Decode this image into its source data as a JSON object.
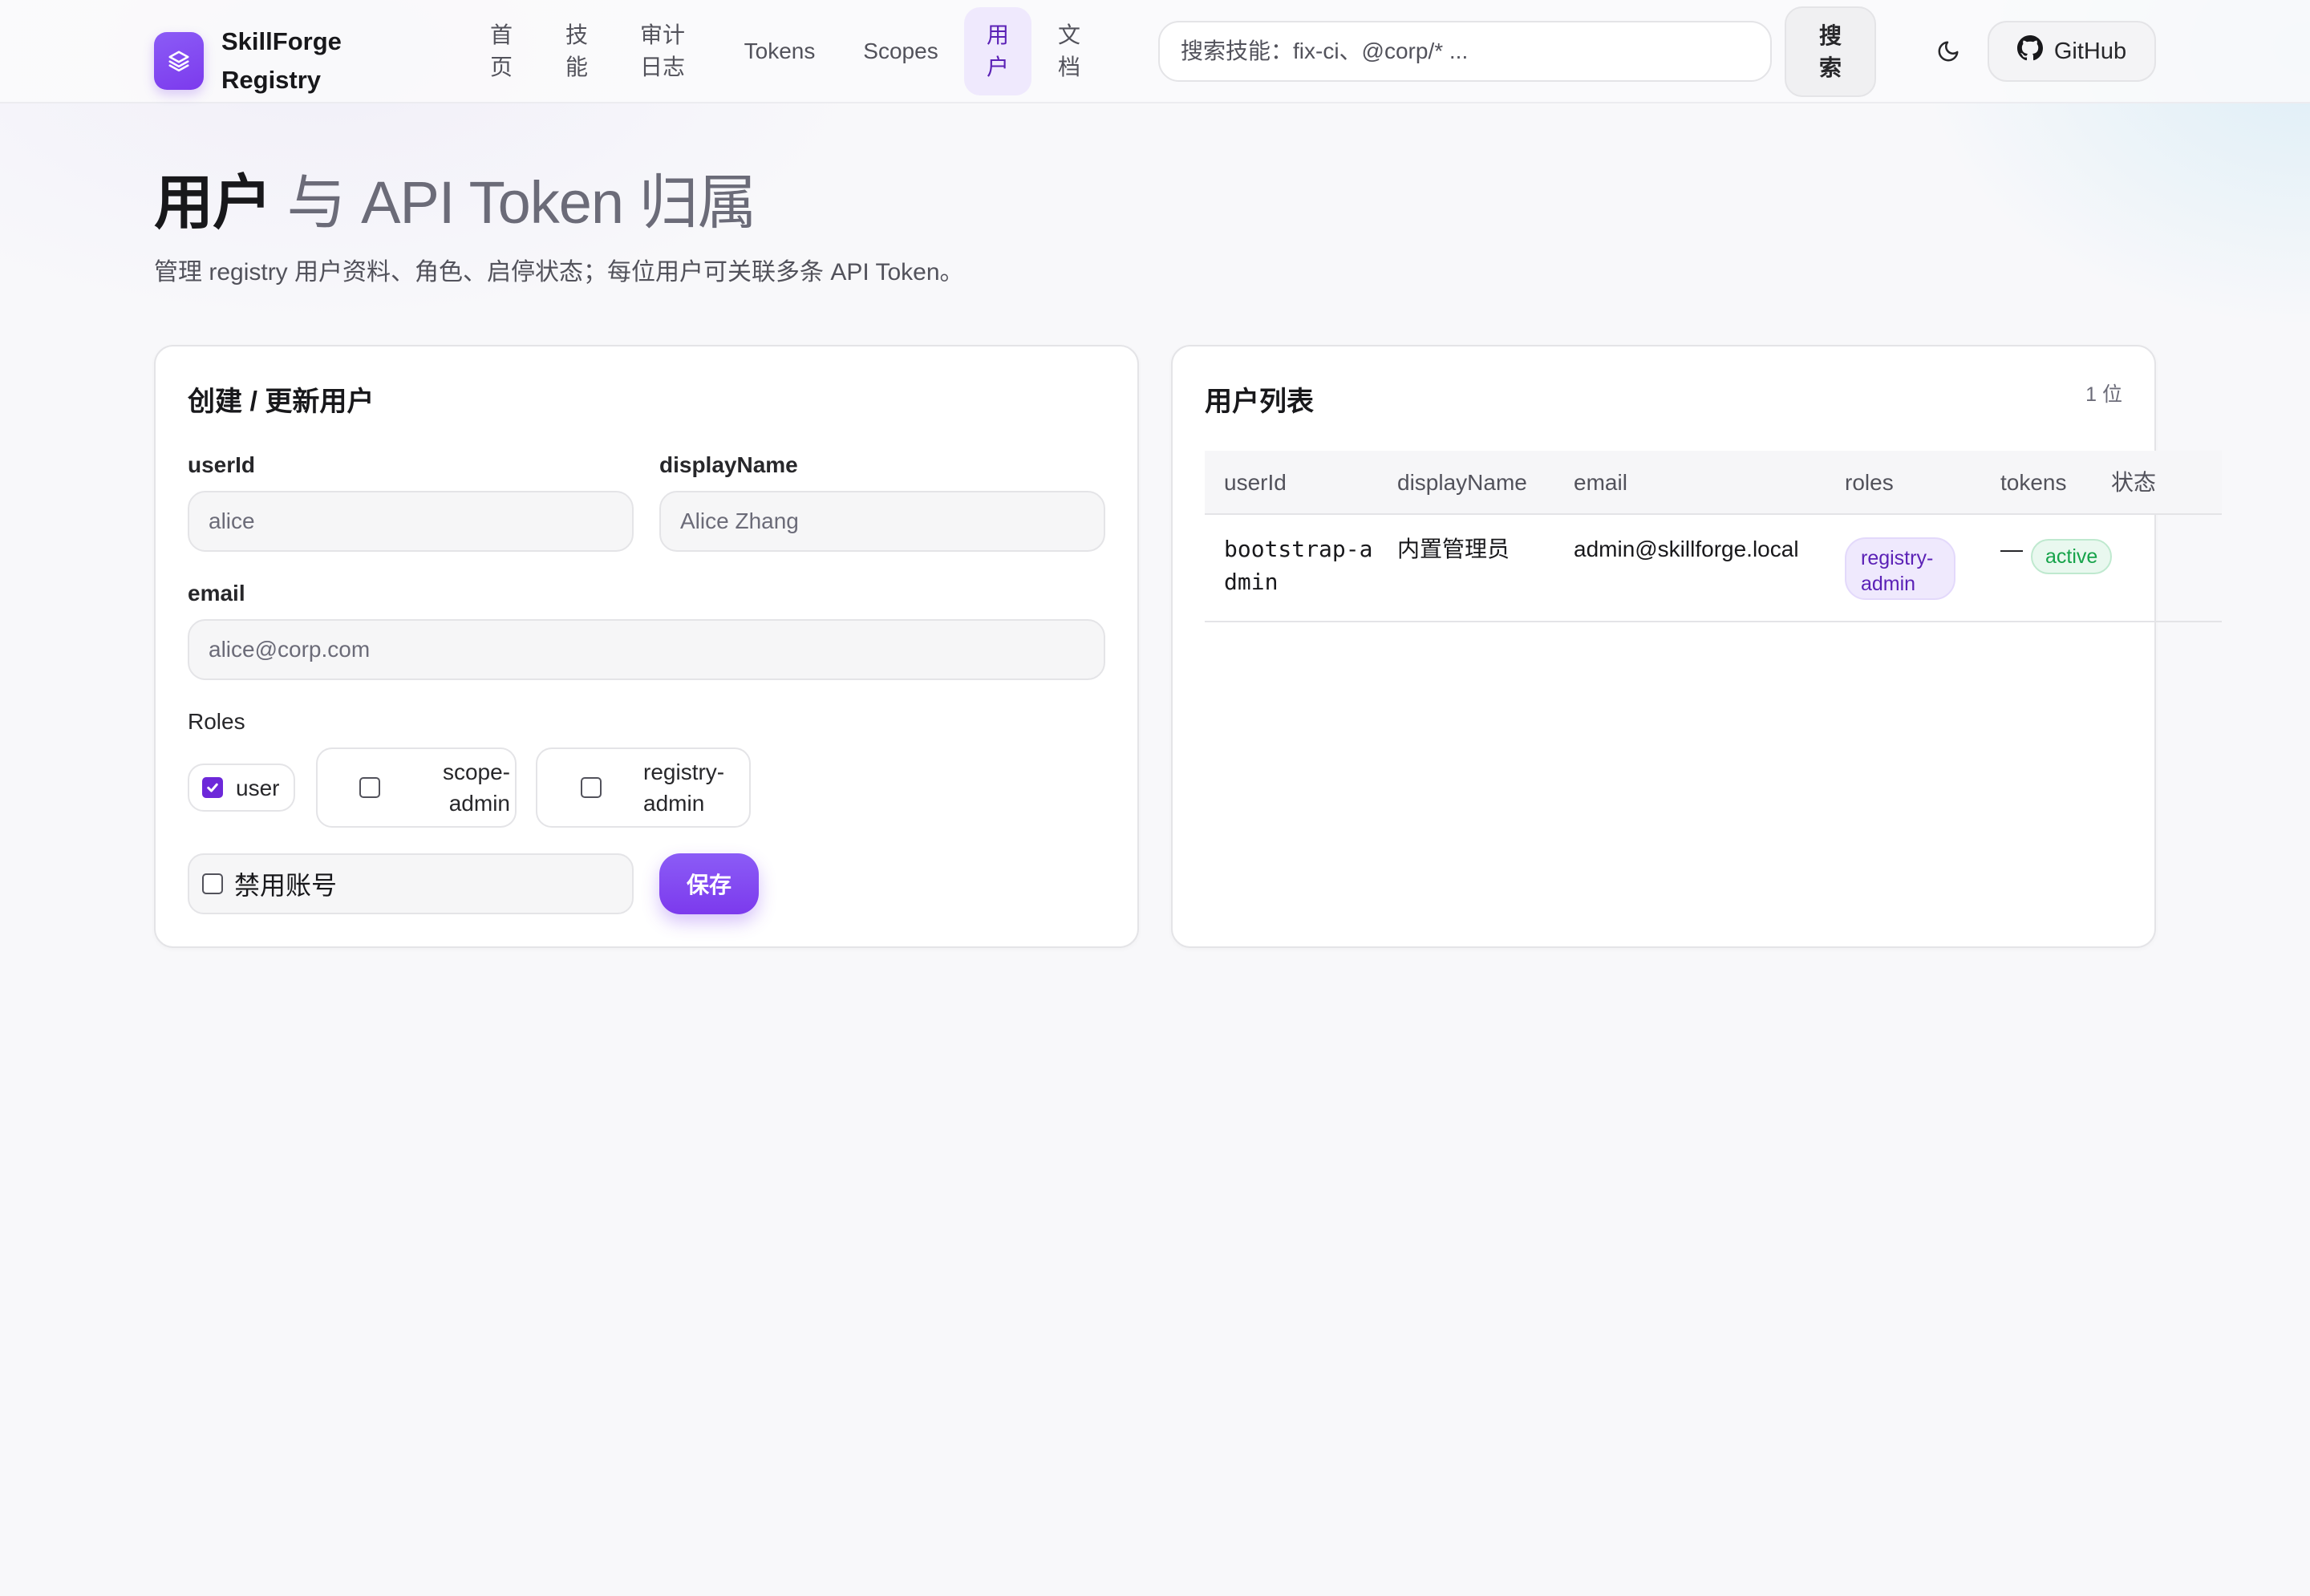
{
  "brand": {
    "name": "SkillForge Registry"
  },
  "nav": {
    "items": [
      {
        "label": "首页"
      },
      {
        "label": "技能"
      },
      {
        "label": "审计日志"
      },
      {
        "label": "Tokens"
      },
      {
        "label": "Scopes"
      },
      {
        "label": "用户",
        "active": true
      },
      {
        "label": "文档"
      }
    ]
  },
  "search": {
    "placeholder": "搜索技能：fix-ci、@corp/* ...",
    "button_label": "搜索"
  },
  "github": {
    "label": "GitHub"
  },
  "page": {
    "title_strong": "用户",
    "title_rest": " 与 API Token 归属",
    "subtitle": "管理 registry 用户资料、角色、启停状态；每位用户可关联多条 API Token。"
  },
  "form": {
    "title": "创建 / 更新用户",
    "userId": {
      "label": "userId",
      "placeholder": "alice"
    },
    "displayName": {
      "label": "displayName",
      "placeholder": "Alice Zhang"
    },
    "email": {
      "label": "email",
      "placeholder": "alice@corp.com"
    },
    "roles_label": "Roles",
    "roles": [
      {
        "label": "user",
        "checked": true
      },
      {
        "label": "scope-admin",
        "checked": false
      },
      {
        "label": "registry-admin",
        "checked": false
      }
    ],
    "disable_label": "禁用账号",
    "save_label": "保存"
  },
  "list": {
    "title": "用户列表",
    "count": "1 位",
    "columns": [
      "userId",
      "displayName",
      "email",
      "roles",
      "tokens",
      "状态"
    ],
    "rows": [
      {
        "userId": "bootstrap-admin",
        "displayName": "内置管理员",
        "email": "admin@skillforge.local",
        "roles": "registry-admin",
        "tokens": "—",
        "status": "active"
      }
    ]
  },
  "colors": {
    "accent": "#7c3aed",
    "active_status": "#16a34a"
  }
}
